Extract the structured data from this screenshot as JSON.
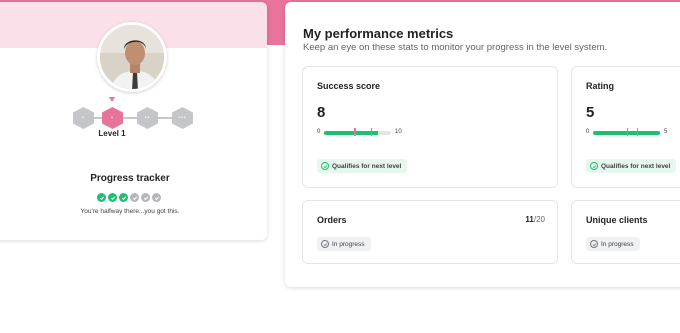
{
  "colors": {
    "brand_pink": "#e8749b",
    "light_pink": "#fbe0ea",
    "success_green": "#1dbf73",
    "muted_grey": "#c5c6c9"
  },
  "profile": {
    "avatar_icon": "user-photo",
    "level_label": "Level 1",
    "levels": [
      {
        "glyph": "•"
      },
      {
        "glyph": "•",
        "current": true
      },
      {
        "glyph": "••"
      },
      {
        "glyph": "•••"
      }
    ],
    "progress_tracker": {
      "title": "Progress tracker",
      "steps_completed": 3,
      "steps_total": 6,
      "subtitle": "You're halfway there...you got this."
    }
  },
  "metrics": {
    "title": "My performance metrics",
    "subtitle": "Keep an eye on these stats to monitor your progress in the level system.",
    "tiles": {
      "success": {
        "title": "Success score",
        "value": "8",
        "scale_min": "0",
        "scale_max": "10",
        "fill_fraction": 0.8,
        "threshold_fractions": [
          0.45,
          0.7
        ],
        "status": "Qualifies for next level",
        "status_icon": "check-circle-icon"
      },
      "rating": {
        "title": "Rating",
        "value": "5",
        "scale_min": "0",
        "scale_max": "5",
        "fill_fraction": 1.0,
        "threshold_fractions": [
          0.5,
          0.65
        ],
        "status": "Qualifies for next level",
        "status_icon": "check-circle-icon"
      },
      "orders": {
        "title": "Orders",
        "count_value": "11",
        "count_total": "/20",
        "status": "In progress",
        "status_icon": "check-circle-icon"
      },
      "clients": {
        "title": "Unique clients",
        "status": "In progress",
        "status_icon": "check-circle-icon"
      }
    }
  }
}
